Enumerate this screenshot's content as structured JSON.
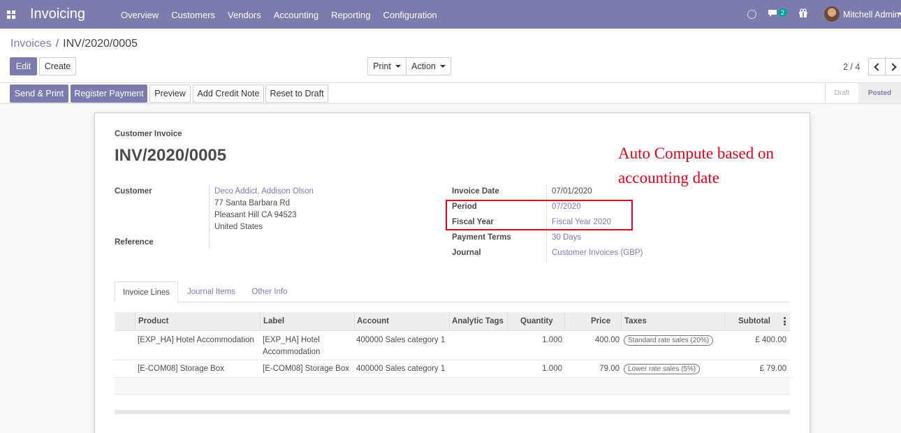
{
  "navbar": {
    "app_name": "Invoicing",
    "menu": [
      "Overview",
      "Customers",
      "Vendors",
      "Accounting",
      "Reporting",
      "Configuration"
    ],
    "chat_count": "2",
    "user_name": "Mitchell Admin",
    "bg_color": "#7c7bad"
  },
  "breadcrumb": {
    "parent": "Invoices",
    "separator": "/",
    "current": "INV/2020/0005"
  },
  "buttons": {
    "edit": "Edit",
    "create": "Create",
    "print": "Print",
    "action": "Action"
  },
  "pager": {
    "value": "2 / 4"
  },
  "statusbar": {
    "send_print": "Send & Print",
    "register_payment": "Register Payment",
    "preview": "Preview",
    "add_credit_note": "Add Credit Note",
    "reset_to_draft": "Reset to Draft",
    "steps": [
      "Draft",
      "Posted"
    ],
    "active_step": "Posted"
  },
  "invoice": {
    "type": "Customer Invoice",
    "name": "INV/2020/0005",
    "customer_label": "Customer",
    "customer_name": "Deco Addict, Addison Olson",
    "address": [
      "77 Santa Barbara Rd",
      "Pleasant Hill CA 94523",
      "United States"
    ],
    "reference_label": "Reference",
    "invoice_date_label": "Invoice Date",
    "invoice_date": "07/01/2020",
    "period_label": "Period",
    "period": "07/2020",
    "fiscal_year_label": "Fiscal Year",
    "fiscal_year": "Fiscal Year 2020",
    "payment_terms_label": "Payment Terms",
    "payment_terms": "30 Days",
    "journal_label": "Journal",
    "journal": "Customer Invoices (GBP)"
  },
  "annotation": {
    "text": "Auto Compute based on accounting date",
    "color": "#e0001b"
  },
  "tabs": [
    "Invoice Lines",
    "Journal Items",
    "Other Info"
  ],
  "lines": {
    "columns": [
      "Product",
      "Label",
      "Account",
      "Analytic Tags",
      "Quantity",
      "Price",
      "Taxes",
      "Subtotal"
    ],
    "rows": [
      {
        "product": "[EXP_HA] Hotel Accommodation",
        "label": "[EXP_HA] Hotel Accommodation",
        "account": "400000 Sales category 1",
        "analytic_tags": "",
        "quantity": "1.000",
        "price": "400.00",
        "taxes": "Standard rate sales (20%)",
        "subtotal": "£ 400.00"
      },
      {
        "product": "[E-COM08] Storage Box",
        "label": "[E-COM08] Storage Box",
        "account": "400000 Sales category 1",
        "analytic_tags": "",
        "quantity": "1.000",
        "price": "79.00",
        "taxes": "Lower rate sales (5%)",
        "subtotal": "£ 79.00"
      }
    ]
  }
}
